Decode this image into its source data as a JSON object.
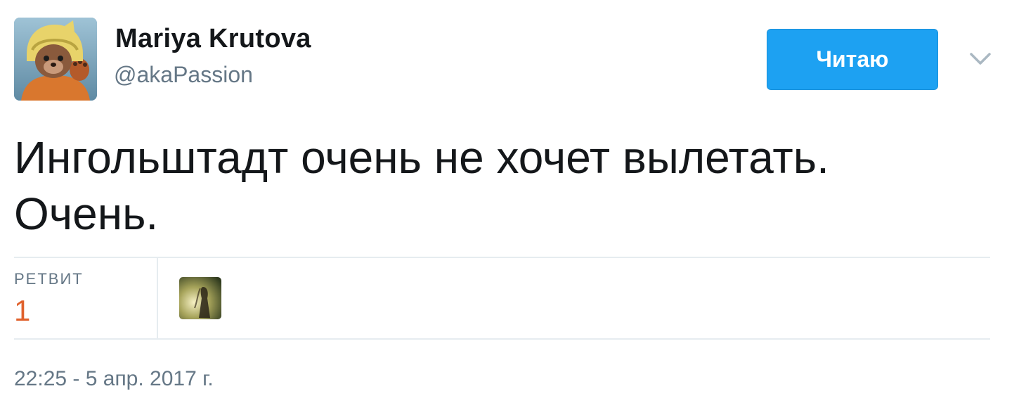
{
  "author": {
    "display_name": "Mariya Krutova",
    "screen_name": "@akaPassion"
  },
  "follow_button": {
    "label": "Читаю"
  },
  "tweet": {
    "text": "Ингольштадт очень не хочет вылетать.\nОчень."
  },
  "stats": {
    "retweet_label": "РЕТВИТ",
    "retweet_count": "1"
  },
  "timestamp": "22:25 - 5 апр. 2017 г.",
  "icons": {
    "caret": "chevron-down-icon"
  },
  "colors": {
    "accent": "#1da1f2",
    "stat_count": "#e0612c",
    "secondary_text": "#657786",
    "divider": "#e6ecf0"
  }
}
